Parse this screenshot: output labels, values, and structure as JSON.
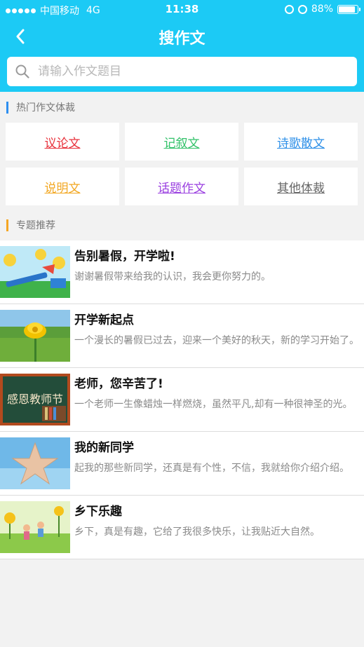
{
  "status_bar": {
    "carrier": "中国移动",
    "network": "4G",
    "time": "11:38",
    "battery": "88%",
    "battery_level": 0.88
  },
  "nav": {
    "title": "搜作文"
  },
  "search": {
    "placeholder": "请输入作文题目"
  },
  "genres": {
    "heading": "热门作文体裁",
    "accent": "#2e8ff0",
    "items": [
      {
        "label": "议论文",
        "color": "#e8323c"
      },
      {
        "label": "记叙文",
        "color": "#33c26a"
      },
      {
        "label": "诗歌散文",
        "color": "#2e90e8"
      },
      {
        "label": "说明文",
        "color": "#f2a722"
      },
      {
        "label": "话题作文",
        "color": "#9a3fe0"
      },
      {
        "label": "其他体裁",
        "color": "#666666"
      }
    ]
  },
  "topics": {
    "heading": "专题推荐",
    "accent": "#f5a623",
    "items": [
      {
        "title": "告别暑假，开学啦!",
        "desc": "谢谢暑假带来给我的认识，我会更你努力的。",
        "icon": "back-to-school-thumbnail"
      },
      {
        "title": "开学新起点",
        "desc": "一个漫长的暑假已过去，迎来一个美好的秋天，新的学习开始了。",
        "icon": "yellow-flower-thumbnail"
      },
      {
        "title": "老师，您辛苦了!",
        "desc": "一个老师一生像蜡烛一样燃烧，虽然平凡,却有一种很神圣的光。",
        "icon": "teachers-day-thumbnail",
        "thumb_text": "感恩教师节"
      },
      {
        "title": "我的新同学",
        "desc": "起我的那些新同学，还真是有个性，不信，我就给你介绍介绍。",
        "icon": "hands-star-thumbnail"
      },
      {
        "title": "乡下乐趣",
        "desc": "乡下，真是有趣，它给了我很多快乐，让我贴近大自然。",
        "icon": "countryside-thumbnail"
      }
    ]
  }
}
